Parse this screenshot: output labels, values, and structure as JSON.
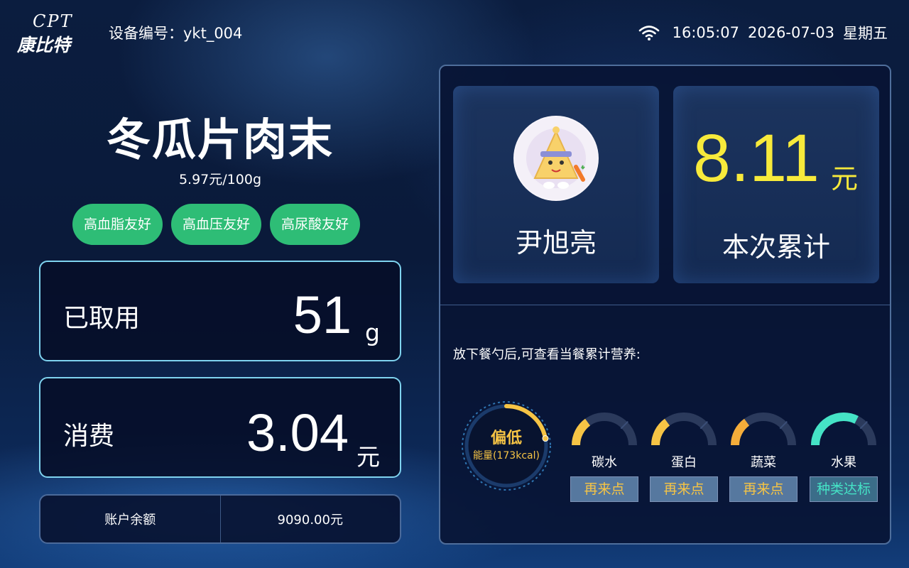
{
  "header": {
    "logo_en": "CPT",
    "logo_cn": "康比特",
    "device": "设备编号：ykt_004",
    "time": "16:05:07",
    "date": "2026-07-03",
    "weekday": "星期五"
  },
  "product": {
    "name": "冬瓜片肉末",
    "price_unit": "5.97元/100g",
    "tags": [
      "高血脂友好",
      "高血压友好",
      "高尿酸友好"
    ]
  },
  "weight": {
    "label": "已取用",
    "value": "51",
    "unit": "g"
  },
  "cost": {
    "label": "消费",
    "value": "3.04",
    "unit": "元"
  },
  "balance": {
    "label": "账户余额",
    "value": "9090.00元"
  },
  "user": {
    "name": "尹旭亮"
  },
  "total": {
    "value": "8.11",
    "unit": "元",
    "label": "本次累计"
  },
  "hint": "放下餐勺后,可查看当餐累计营养:",
  "energy": {
    "status": "偏低",
    "label": "能量(173kcal)",
    "level": 0.22
  },
  "nutrients": [
    {
      "label": "碳水",
      "status": "再来点",
      "level": 0.3,
      "color": "#f6c445",
      "kind": "low"
    },
    {
      "label": "蛋白",
      "status": "再来点",
      "level": 0.3,
      "color": "#f6c445",
      "kind": "low"
    },
    {
      "label": "蔬菜",
      "status": "再来点",
      "level": 0.3,
      "color": "#f5ad3a",
      "kind": "low"
    },
    {
      "label": "水果",
      "status": "种类达标",
      "level": 0.65,
      "color": "#45e3c6",
      "kind": "ok"
    }
  ],
  "colors": {
    "accent_green": "#2ebd76",
    "accent_yellow": "#f7ea3b",
    "energy": "#f6c445"
  }
}
